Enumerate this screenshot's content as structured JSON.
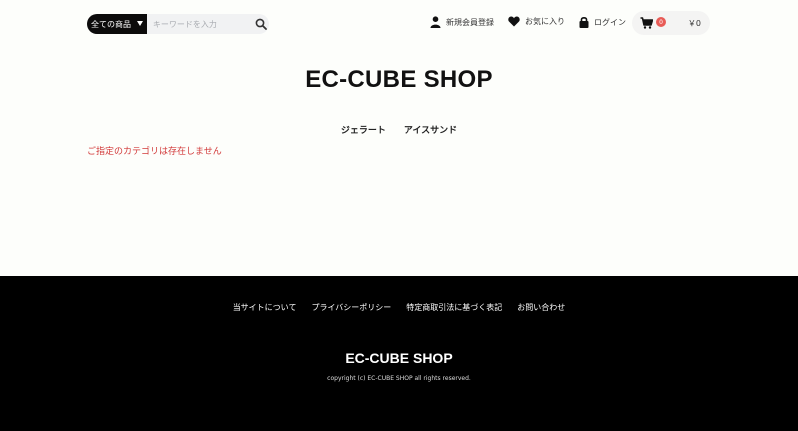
{
  "header": {
    "category_select": "全ての商品",
    "search_placeholder": "キーワードを入力",
    "register_label": "新規会員登録",
    "favorite_label": "お気に入り",
    "login_label": "ログイン",
    "cart_count": "0",
    "cart_price": "￥0"
  },
  "site": {
    "logo": "EC-CUBE SHOP"
  },
  "gnav": {
    "items": [
      "ジェラート",
      "アイスサンド"
    ]
  },
  "main": {
    "error_message": "ご指定のカテゴリは存在しません"
  },
  "footer": {
    "links": [
      "当サイトについて",
      "プライバシーポリシー",
      "特定商取引法に基づく表記",
      "お問い合わせ"
    ],
    "logo": "EC-CUBE SHOP",
    "copyright": "copyright (c) EC-CUBE SHOP all rights reserved."
  },
  "colors": {
    "error": "#d23a3a",
    "cart_badge": "#e85b56",
    "footer_bg": "#000000"
  },
  "icons": [
    "chevron-down-icon",
    "search-icon",
    "user-icon",
    "heart-icon",
    "lock-icon",
    "cart-icon"
  ]
}
